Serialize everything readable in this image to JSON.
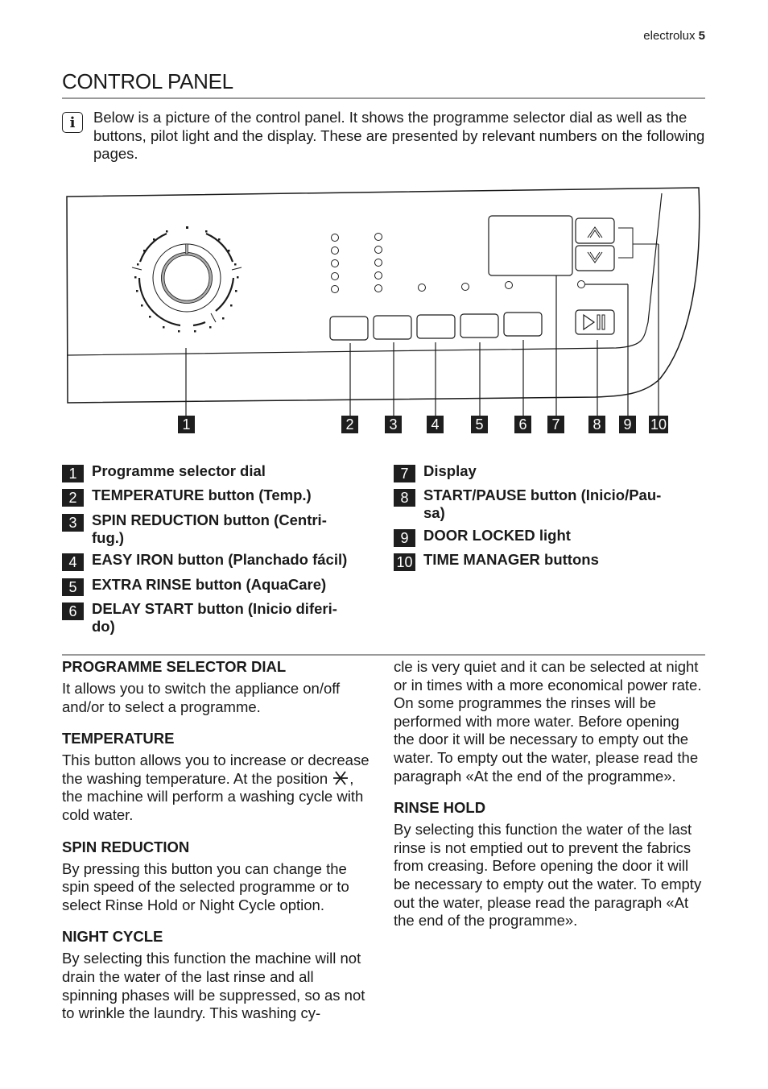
{
  "header": {
    "brand": "electrolux",
    "page_number": "5"
  },
  "page_title": "CONTROL PANEL",
  "info": {
    "icon": "info-icon",
    "text": "Below is a picture of the control panel. It shows the programme selector dial as well as the buttons, pilot light and the display. These are presented by relevant numbers on the following pages."
  },
  "diagram": {
    "callouts": [
      "1",
      "2",
      "3",
      "4",
      "5",
      "6",
      "7",
      "8",
      "9",
      "10"
    ],
    "start_pause_icon": "play-pause-icon",
    "up_icon": "chevron-up-icon",
    "down_icon": "chevron-down-icon"
  },
  "legend": {
    "left": [
      {
        "num": "1",
        "label": "Programme selector dial"
      },
      {
        "num": "2",
        "label": "TEMPERATURE button (Temp.)"
      },
      {
        "num": "3",
        "label": "SPIN REDUCTION button (Centri-\nfug.)"
      },
      {
        "num": "4",
        "label": "EASY IRON button (Planchado fácil)"
      },
      {
        "num": "5",
        "label": "EXTRA RINSE button (AquaCare)"
      },
      {
        "num": "6",
        "label": "DELAY START button (Inicio diferi-\ndo)"
      }
    ],
    "right": [
      {
        "num": "7",
        "label": "Display"
      },
      {
        "num": "8",
        "label": "START/PAUSE button (Inicio/Pau-\nsa)"
      },
      {
        "num": "9",
        "label": "DOOR LOCKED light"
      },
      {
        "num": "10",
        "label": "TIME MANAGER buttons"
      }
    ]
  },
  "sections": {
    "programme_selector": {
      "heading": "PROGRAMME SELECTOR DIAL",
      "body": "It allows you to switch the appliance on/off and/or to select a programme."
    },
    "temperature": {
      "heading": "TEMPERATURE",
      "body_before": "This button allows you to increase or de­crease the washing temperature. At the po­sition",
      "body_after": ", the machine will perform a wash­ing cycle with cold water.",
      "icon": "cold-water-icon"
    },
    "spin_reduction": {
      "heading": "SPIN REDUCTION",
      "body": "By pressing this button you can change the spin speed of the selected programme or to select Rinse Hold or Night Cycle option."
    },
    "night_cycle": {
      "heading": "NIGHT CYCLE",
      "body_left": "By selecting this function the machine will not drain the water of the last rinse and all spinning phases will be suppressed, so as not to wrinkle the laundry. This washing cy-",
      "body_right": "cle is very quiet and it can be selected at night or in times with a more economical power rate. On some programmes the rin­ses will be performed with more water. Be­fore opening the door it will be necessary to empty out the water. To empty out the wa­ter, please read the paragraph «At the end of the programme»."
    },
    "rinse_hold": {
      "heading": "RINSE HOLD",
      "body": "By selecting this function the water of the last rinse is not emptied out to prevent the fabrics from creasing. Before opening the door it will be necessary to empty out the water. To empty out the water, please read the paragraph «At the end of the pro­gramme»."
    }
  }
}
